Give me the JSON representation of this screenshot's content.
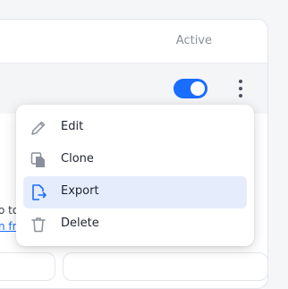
{
  "table": {
    "active_header": "Active"
  },
  "background": {
    "partial_text_1": "o to",
    "partial_link": "n fr"
  },
  "menu": {
    "items": [
      {
        "label": "Edit",
        "icon": "pencil-icon"
      },
      {
        "label": "Clone",
        "icon": "copy-icon"
      },
      {
        "label": "Export",
        "icon": "export-icon",
        "highlighted": true
      },
      {
        "label": "Delete",
        "icon": "trash-icon"
      }
    ]
  },
  "toggle": {
    "state": "on"
  },
  "colors": {
    "accent": "#1a6dff",
    "highlight": "#e5edfd",
    "icon": "#8a909a"
  }
}
